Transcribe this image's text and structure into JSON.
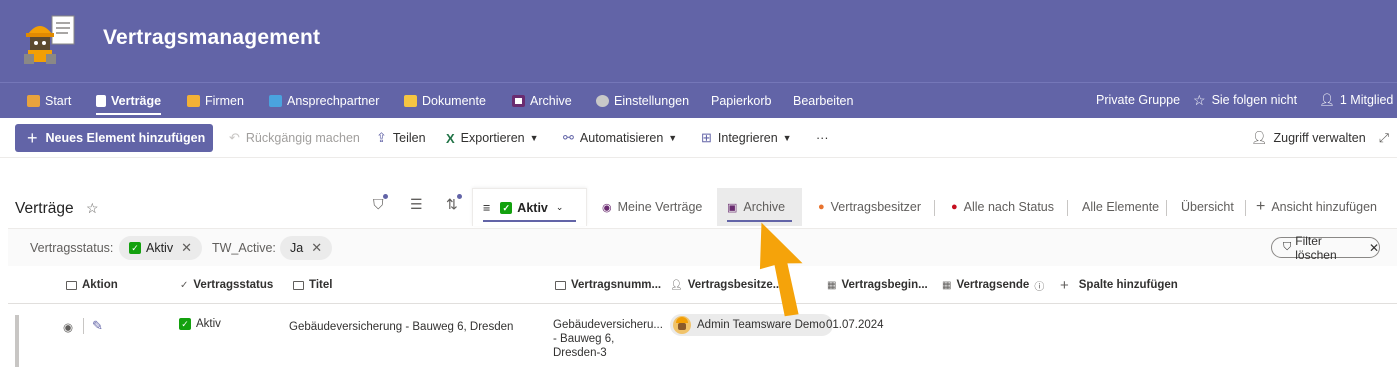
{
  "site": {
    "title": "Vertragsmanagement"
  },
  "nav": {
    "items": [
      {
        "label": "Start",
        "icon": "house-icon",
        "color": "#e8a33d"
      },
      {
        "label": "Verträge",
        "icon": "document-icon",
        "color": "#ffffff",
        "active": true
      },
      {
        "label": "Firmen",
        "icon": "handshake-icon",
        "color": "#f2b136"
      },
      {
        "label": "Ansprechpartner",
        "icon": "contact-card-icon",
        "color": "#4aa3df"
      },
      {
        "label": "Dokumente",
        "icon": "folder-icon",
        "color": "#f5c542"
      },
      {
        "label": "Archive",
        "icon": "floppy-disk-icon",
        "color": "#ffffff"
      },
      {
        "label": "Einstellungen",
        "icon": "gear-icon",
        "color": "#c8c8c8"
      },
      {
        "label": "Papierkorb"
      },
      {
        "label": "Bearbeiten"
      }
    ],
    "private_group": "Private Gruppe",
    "follow": "Sie folgen nicht",
    "members": "1 Mitglied"
  },
  "commands": {
    "new_item": "Neues Element hinzufügen",
    "undo": "Rückgängig machen",
    "share": "Teilen",
    "export": "Exportieren",
    "automate": "Automatisieren",
    "integrate": "Integrieren",
    "more": "···",
    "manage_access": "Zugriff verwalten"
  },
  "view": {
    "list_title": "Verträge",
    "tabs": [
      {
        "label": "Aktiv",
        "active": true
      },
      {
        "label": "Meine Verträge"
      },
      {
        "label": "Archive",
        "hovered": true
      },
      {
        "label": "Vertragsbesitzer"
      },
      {
        "label": "Alle nach Status"
      },
      {
        "label": "Alle Elemente"
      },
      {
        "label": "Übersicht"
      }
    ],
    "add_view": "Ansicht hinzufügen"
  },
  "filters": {
    "status_label": "Vertragsstatus:",
    "status_value": "Aktiv",
    "tw_label": "TW_Active:",
    "tw_value": "Ja",
    "clear": "Filter löschen"
  },
  "columns": {
    "action": "Aktion",
    "status": "Vertragsstatus",
    "title": "Titel",
    "number": "Vertragsnumm...",
    "owner": "Vertragsbesitze...",
    "begin": "Vertragsbegin...",
    "end": "Vertragsende",
    "add": "Spalte hinzufügen"
  },
  "rows": [
    {
      "status": "Aktiv",
      "title": "Gebäudeversicherung - Bauweg 6, Dresden",
      "number_l1": "Gebäudeversicheru...",
      "number_l2": "- Bauweg 6,",
      "number_l3": "Dresden-3",
      "owner": "Admin Teamsware Demo",
      "begin": "01.07.2024"
    }
  ],
  "colors": {
    "brand": "#6264a7",
    "accent_arrow": "#f5a30a",
    "status_green": "#13a10e"
  }
}
